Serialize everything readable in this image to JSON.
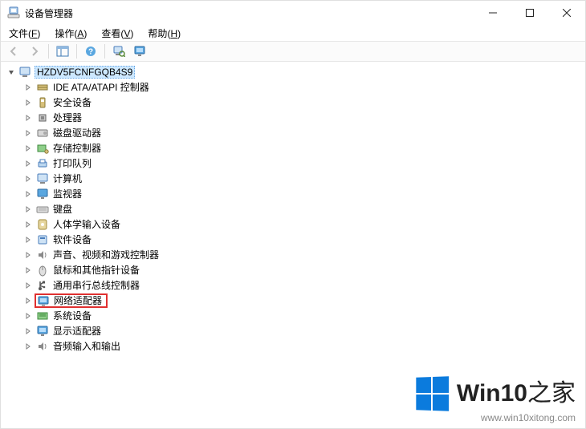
{
  "window": {
    "title": "设备管理器"
  },
  "menubar": {
    "file": {
      "label": "文件",
      "accel": "F"
    },
    "action": {
      "label": "操作",
      "accel": "A"
    },
    "view": {
      "label": "查看",
      "accel": "V"
    },
    "help": {
      "label": "帮助",
      "accel": "H"
    }
  },
  "toolbar": {
    "back": "back-icon",
    "forward": "forward-icon",
    "pane": "show-hide-pane-icon",
    "help": "help-icon",
    "scan": "scan-hardware-icon",
    "monitor": "monitor-icon"
  },
  "tree": {
    "root": {
      "label": "HZDV5FCNFGQB4S9",
      "expanded": true
    },
    "nodes": [
      {
        "label": "IDE ATA/ATAPI 控制器",
        "icon": "ide-controller",
        "highlight": false
      },
      {
        "label": "安全设备",
        "icon": "security-device",
        "highlight": false
      },
      {
        "label": "处理器",
        "icon": "processor",
        "highlight": false
      },
      {
        "label": "磁盘驱动器",
        "icon": "disk-drive",
        "highlight": false
      },
      {
        "label": "存储控制器",
        "icon": "storage-controller",
        "highlight": false
      },
      {
        "label": "打印队列",
        "icon": "print-queue",
        "highlight": false
      },
      {
        "label": "计算机",
        "icon": "computer",
        "highlight": false
      },
      {
        "label": "监视器",
        "icon": "monitor",
        "highlight": false
      },
      {
        "label": "键盘",
        "icon": "keyboard",
        "highlight": false
      },
      {
        "label": "人体学输入设备",
        "icon": "hid",
        "highlight": false
      },
      {
        "label": "软件设备",
        "icon": "software-device",
        "highlight": false
      },
      {
        "label": "声音、视频和游戏控制器",
        "icon": "sound",
        "highlight": false
      },
      {
        "label": "鼠标和其他指针设备",
        "icon": "mouse",
        "highlight": false
      },
      {
        "label": "通用串行总线控制器",
        "icon": "usb",
        "highlight": false
      },
      {
        "label": "网络适配器",
        "icon": "network",
        "highlight": true
      },
      {
        "label": "系统设备",
        "icon": "system",
        "highlight": false
      },
      {
        "label": "显示适配器",
        "icon": "display",
        "highlight": false
      },
      {
        "label": "音频输入和输出",
        "icon": "audio-io",
        "highlight": false
      }
    ]
  },
  "watermark": {
    "brand_prefix": "Win10",
    "brand_suffix": "之家",
    "url": "www.win10xitong.com"
  }
}
